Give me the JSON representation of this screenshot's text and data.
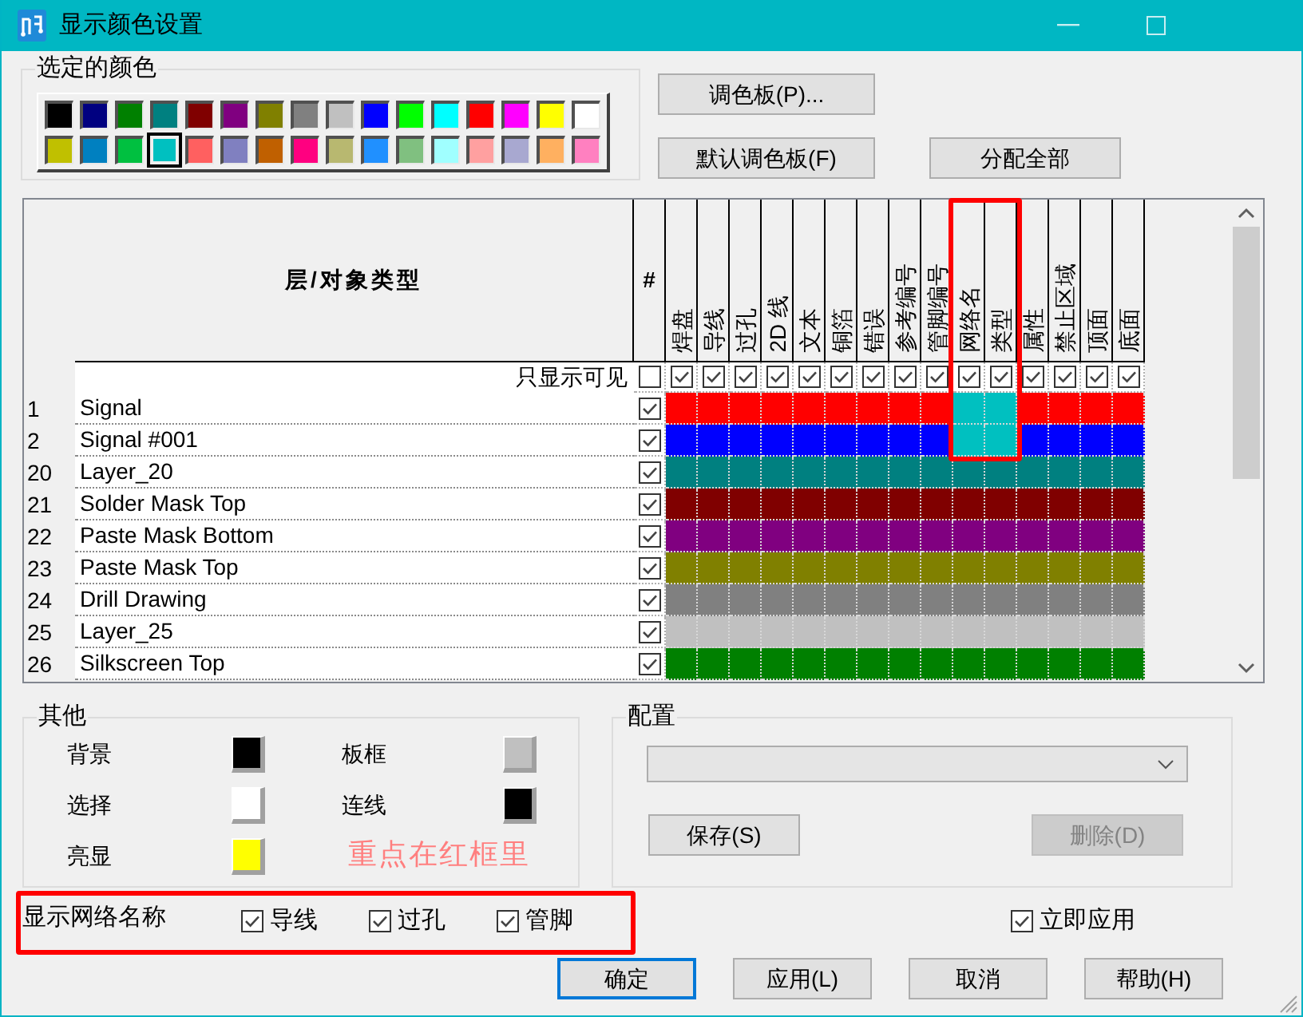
{
  "window": {
    "title": "显示颜色设置"
  },
  "selected_colors": {
    "label": "选定的颜色",
    "swatches": [
      {
        "color": "#000000",
        "selected": false
      },
      {
        "color": "#000080",
        "selected": false
      },
      {
        "color": "#008000",
        "selected": false
      },
      {
        "color": "#008080",
        "selected": false
      },
      {
        "color": "#800000",
        "selected": false
      },
      {
        "color": "#800080",
        "selected": false
      },
      {
        "color": "#808000",
        "selected": false
      },
      {
        "color": "#808080",
        "selected": false
      },
      {
        "color": "#c0c0c0",
        "selected": false
      },
      {
        "color": "#0000ff",
        "selected": false
      },
      {
        "color": "#00ff00",
        "selected": false
      },
      {
        "color": "#00ffff",
        "selected": false
      },
      {
        "color": "#ff0000",
        "selected": false
      },
      {
        "color": "#ff00ff",
        "selected": false
      },
      {
        "color": "#ffff00",
        "selected": false
      },
      {
        "color": "#ffffff",
        "selected": false
      },
      {
        "color": "#c0c000",
        "selected": false
      },
      {
        "color": "#0080c0",
        "selected": false
      },
      {
        "color": "#00c040",
        "selected": false
      },
      {
        "color": "#00c0c0",
        "selected": true
      },
      {
        "color": "#ff6060",
        "selected": false
      },
      {
        "color": "#8080c0",
        "selected": false
      },
      {
        "color": "#c06000",
        "selected": false
      },
      {
        "color": "#ff0080",
        "selected": false
      },
      {
        "color": "#b8b870",
        "selected": false
      },
      {
        "color": "#2090ff",
        "selected": false
      },
      {
        "color": "#80c080",
        "selected": false
      },
      {
        "color": "#a0ffff",
        "selected": false
      },
      {
        "color": "#ffa0a0",
        "selected": false
      },
      {
        "color": "#a8a8d0",
        "selected": false
      },
      {
        "color": "#ffb060",
        "selected": false
      },
      {
        "color": "#ff80c0",
        "selected": false
      }
    ]
  },
  "palette_button": "调色板(P)...",
  "default_palette_button": "默认调色板(F)",
  "assign_all_button": "分配全部",
  "table": {
    "name_header": "层/对象类型",
    "visible_header": "#",
    "filter_row": {
      "label": "只显示可见",
      "checked": false
    },
    "columns": [
      {
        "label": "焊盘",
        "checked": true,
        "annotated": false
      },
      {
        "label": "导线",
        "checked": true,
        "annotated": false
      },
      {
        "label": "过孔",
        "checked": true,
        "annotated": false
      },
      {
        "label": "2D 线",
        "checked": true,
        "annotated": false
      },
      {
        "label": "文本",
        "checked": true,
        "annotated": false
      },
      {
        "label": "铜箔",
        "checked": true,
        "annotated": false
      },
      {
        "label": "错误",
        "checked": true,
        "annotated": false
      },
      {
        "label": "参考编号",
        "checked": true,
        "annotated": false
      },
      {
        "label": "管脚编号",
        "checked": true,
        "annotated": false
      },
      {
        "label": "网络名",
        "checked": true,
        "annotated": true
      },
      {
        "label": "类型",
        "checked": true,
        "annotated": true
      },
      {
        "label": "属性",
        "checked": true,
        "annotated": false
      },
      {
        "label": "禁止区域",
        "checked": true,
        "annotated": false
      },
      {
        "label": "顶面",
        "checked": true,
        "annotated": false
      },
      {
        "label": "底面",
        "checked": true,
        "annotated": false
      }
    ],
    "rows": [
      {
        "number": "1",
        "name": "Signal",
        "visible": true,
        "annotated": true,
        "cells": [
          {
            "color": "#ff0000"
          },
          {
            "color": "#ff0000"
          },
          {
            "color": "#ff0000"
          },
          {
            "color": "#ff0000"
          },
          {
            "color": "#ff0000"
          },
          {
            "color": "#ff0000"
          },
          {
            "color": "#ff0000"
          },
          {
            "color": "#ff0000"
          },
          {
            "color": "#ff0000"
          },
          {
            "color": "#00c0c0"
          },
          {
            "color": "#00c0c0"
          },
          {
            "color": "#ff0000"
          },
          {
            "color": "#ff0000"
          },
          {
            "color": "#ff0000"
          },
          {
            "color": "#ff0000"
          }
        ]
      },
      {
        "number": "2",
        "name": "Signal #001",
        "visible": true,
        "annotated": true,
        "cells": [
          {
            "color": "#0000ff"
          },
          {
            "color": "#0000ff"
          },
          {
            "color": "#0000ff"
          },
          {
            "color": "#0000ff"
          },
          {
            "color": "#0000ff"
          },
          {
            "color": "#0000ff"
          },
          {
            "color": "#0000ff"
          },
          {
            "color": "#0000ff"
          },
          {
            "color": "#0000ff"
          },
          {
            "color": "#00c0c0"
          },
          {
            "color": "#00c0c0"
          },
          {
            "color": "#0000ff"
          },
          {
            "color": "#0000ff"
          },
          {
            "color": "#0000ff"
          },
          {
            "color": "#0000ff"
          }
        ]
      },
      {
        "number": "20",
        "name": "Layer_20",
        "visible": true,
        "annotated": false,
        "cells": [
          {
            "color": "#008080"
          },
          {
            "color": "#008080"
          },
          {
            "color": "#008080"
          },
          {
            "color": "#008080"
          },
          {
            "color": "#008080"
          },
          {
            "color": "#008080"
          },
          {
            "color": "#008080"
          },
          {
            "color": "#008080"
          },
          {
            "color": "#008080"
          },
          {
            "color": "#008080"
          },
          {
            "color": "#008080"
          },
          {
            "color": "#008080"
          },
          {
            "color": "#008080"
          },
          {
            "color": "#008080"
          },
          {
            "color": "#008080"
          }
        ]
      },
      {
        "number": "21",
        "name": "Solder Mask Top",
        "visible": true,
        "annotated": false,
        "cells": [
          {
            "color": "#800000"
          },
          {
            "color": "#800000"
          },
          {
            "color": "#800000"
          },
          {
            "color": "#800000"
          },
          {
            "color": "#800000"
          },
          {
            "color": "#800000"
          },
          {
            "color": "#800000"
          },
          {
            "color": "#800000"
          },
          {
            "color": "#800000"
          },
          {
            "color": "#800000"
          },
          {
            "color": "#800000"
          },
          {
            "color": "#800000"
          },
          {
            "color": "#800000"
          },
          {
            "color": "#800000"
          },
          {
            "color": "#800000"
          }
        ]
      },
      {
        "number": "22",
        "name": "Paste Mask Bottom",
        "visible": true,
        "annotated": false,
        "cells": [
          {
            "color": "#800080"
          },
          {
            "color": "#800080"
          },
          {
            "color": "#800080"
          },
          {
            "color": "#800080"
          },
          {
            "color": "#800080"
          },
          {
            "color": "#800080"
          },
          {
            "color": "#800080"
          },
          {
            "color": "#800080"
          },
          {
            "color": "#800080"
          },
          {
            "color": "#800080"
          },
          {
            "color": "#800080"
          },
          {
            "color": "#800080"
          },
          {
            "color": "#800080"
          },
          {
            "color": "#800080"
          },
          {
            "color": "#800080"
          }
        ]
      },
      {
        "number": "23",
        "name": "Paste Mask Top",
        "visible": true,
        "annotated": false,
        "cells": [
          {
            "color": "#808000"
          },
          {
            "color": "#808000"
          },
          {
            "color": "#808000"
          },
          {
            "color": "#808000"
          },
          {
            "color": "#808000"
          },
          {
            "color": "#808000"
          },
          {
            "color": "#808000"
          },
          {
            "color": "#808000"
          },
          {
            "color": "#808000"
          },
          {
            "color": "#808000"
          },
          {
            "color": "#808000"
          },
          {
            "color": "#808000"
          },
          {
            "color": "#808000"
          },
          {
            "color": "#808000"
          },
          {
            "color": "#808000"
          }
        ]
      },
      {
        "number": "24",
        "name": "Drill Drawing",
        "visible": true,
        "annotated": false,
        "cells": [
          {
            "color": "#808080"
          },
          {
            "color": "#808080"
          },
          {
            "color": "#808080"
          },
          {
            "color": "#808080"
          },
          {
            "color": "#808080"
          },
          {
            "color": "#808080"
          },
          {
            "color": "#808080"
          },
          {
            "color": "#808080"
          },
          {
            "color": "#808080"
          },
          {
            "color": "#808080"
          },
          {
            "color": "#808080"
          },
          {
            "color": "#808080"
          },
          {
            "color": "#808080"
          },
          {
            "color": "#808080"
          },
          {
            "color": "#808080"
          }
        ]
      },
      {
        "number": "25",
        "name": "Layer_25",
        "visible": true,
        "annotated": false,
        "cells": [
          {
            "color": "#c0c0c0"
          },
          {
            "color": "#c0c0c0"
          },
          {
            "color": "#c0c0c0"
          },
          {
            "color": "#c0c0c0"
          },
          {
            "color": "#c0c0c0"
          },
          {
            "color": "#c0c0c0"
          },
          {
            "color": "#c0c0c0"
          },
          {
            "color": "#c0c0c0"
          },
          {
            "color": "#c0c0c0"
          },
          {
            "color": "#c0c0c0"
          },
          {
            "color": "#c0c0c0"
          },
          {
            "color": "#c0c0c0"
          },
          {
            "color": "#c0c0c0"
          },
          {
            "color": "#c0c0c0"
          },
          {
            "color": "#c0c0c0"
          }
        ]
      },
      {
        "number": "26",
        "name": "Silkscreen Top",
        "visible": true,
        "annotated": false,
        "cells": [
          {
            "color": "#008000"
          },
          {
            "color": "#008000"
          },
          {
            "color": "#008000"
          },
          {
            "color": "#008000"
          },
          {
            "color": "#008000"
          },
          {
            "color": "#008000"
          },
          {
            "color": "#008000"
          },
          {
            "color": "#008000"
          },
          {
            "color": "#008000"
          },
          {
            "color": "#008000"
          },
          {
            "color": "#008000"
          },
          {
            "color": "#008000"
          },
          {
            "color": "#008000"
          },
          {
            "color": "#008000"
          },
          {
            "color": "#008000"
          }
        ]
      }
    ]
  },
  "other": {
    "label": "其他",
    "items": [
      {
        "label": "背景",
        "color": "#000000"
      },
      {
        "label": "板框",
        "color": "#c0c0c0"
      },
      {
        "label": "选择",
        "color": "#ffffff"
      },
      {
        "label": "连线",
        "color": "#000000"
      },
      {
        "label": "亮显",
        "color": "#ffff00"
      }
    ]
  },
  "note": {
    "text": "重点在红框里"
  },
  "config": {
    "label": "配置",
    "buttons": [
      {
        "label": "保存(S)",
        "disabled": false
      },
      {
        "label": "删除(D)",
        "disabled": true
      }
    ]
  },
  "net_names": {
    "label": "显示网络名称",
    "annotated": true,
    "options": [
      {
        "label": "导线",
        "checked": true
      },
      {
        "label": "过孔",
        "checked": true
      },
      {
        "label": "管脚",
        "checked": true
      }
    ]
  },
  "apply_immediately": {
    "label": "立即应用",
    "checked": true
  },
  "dialog_buttons": [
    {
      "label": "确定",
      "default": true
    },
    {
      "label": "应用(L)",
      "default": false
    },
    {
      "label": "取消",
      "default": false
    },
    {
      "label": "帮助(H)",
      "default": false
    }
  ]
}
